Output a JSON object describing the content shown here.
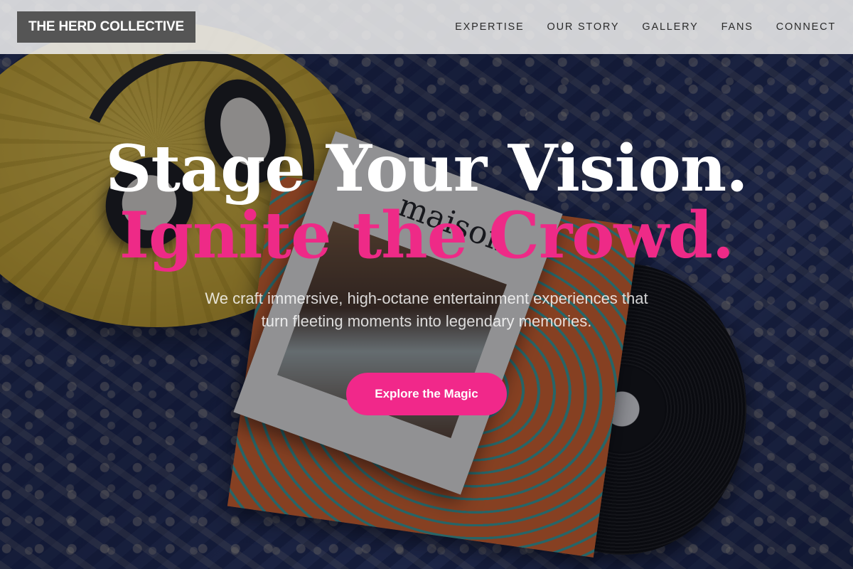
{
  "header": {
    "logo": "THE HERD COLLECTIVE",
    "nav": [
      {
        "label": "EXPERTISE"
      },
      {
        "label": "OUR STORY"
      },
      {
        "label": "GALLERY"
      },
      {
        "label": "FANS"
      },
      {
        "label": "CONNECT"
      }
    ]
  },
  "hero": {
    "headline_line1": "Stage Your Vision.",
    "headline_line2": "Ignite the Crowd.",
    "subtext": "We craft immersive, high-octane entertainment experiences that turn fleeting moments into legendary memories.",
    "cta_label": "Explore the Magic",
    "magazine_title": "maison"
  },
  "colors": {
    "accent": "#f1288a",
    "header_bg": "#ececec",
    "logo_bg": "#555555"
  }
}
